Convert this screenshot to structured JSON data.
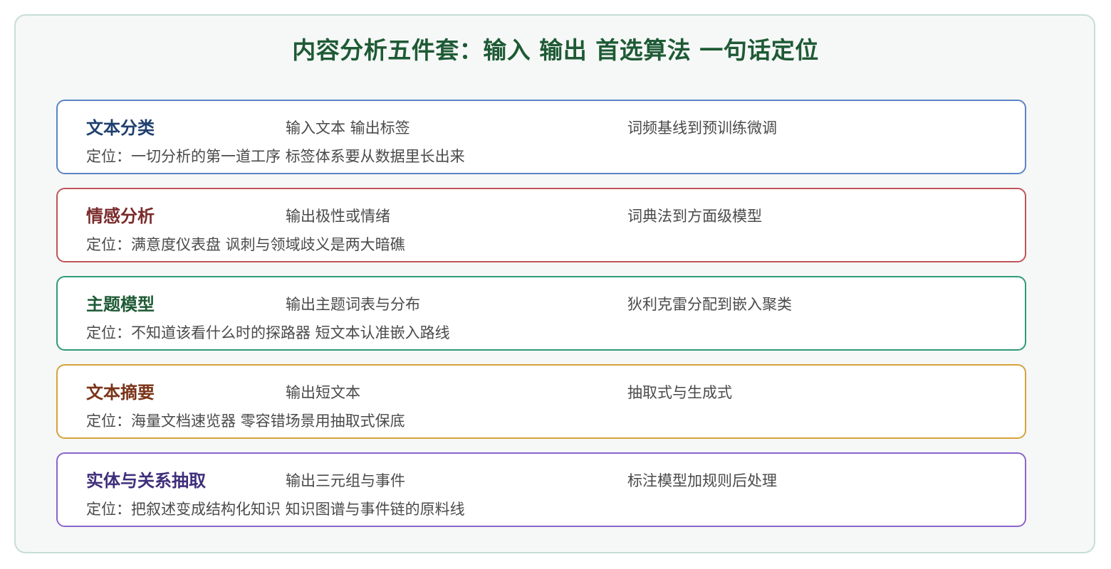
{
  "title": "内容分析五件套：输入 输出 首选算法 一句话定位",
  "cards": [
    {
      "name": "文本分类",
      "io": "输入文本 输出标签",
      "algorithm": "词频基线到预训练微调",
      "position": "定位：一切分析的第一道工序 标签体系要从数据里长出来",
      "color": "#1f3f6e",
      "border": "#5a84c4"
    },
    {
      "name": "情感分析",
      "io": "输出极性或情绪",
      "algorithm": "词典法到方面级模型",
      "position": "定位：满意度仪表盘 讽刺与领域歧义是两大暗礁",
      "color": "#7a2a2a",
      "border": "#c0545b"
    },
    {
      "name": "主题模型",
      "io": "输出主题词表与分布",
      "algorithm": "狄利克雷分配到嵌入聚类",
      "position": "定位：不知道该看什么时的探路器 短文本认准嵌入路线",
      "color": "#1e5a35",
      "border": "#2e9a78"
    },
    {
      "name": "文本摘要",
      "io": "输出短文本",
      "algorithm": "抽取式与生成式",
      "position": "定位：海量文档速览器 零容错场景用抽取式保底",
      "color": "#7a3318",
      "border": "#d6a23a"
    },
    {
      "name": "实体与关系抽取",
      "io": "输出三元组与事件",
      "algorithm": "标注模型加规则后处理",
      "position": "定位：把叙述变成结构化知识 知识图谱与事件链的原料线",
      "color": "#3f2e7a",
      "border": "#8a64cc"
    }
  ]
}
